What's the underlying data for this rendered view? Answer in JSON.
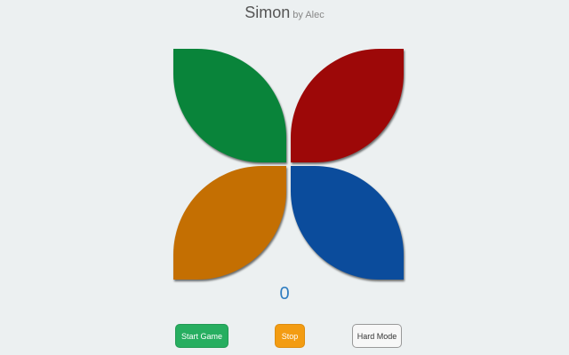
{
  "header": {
    "title": "Simon",
    "subtitle": "by Alec"
  },
  "board": {
    "pads": [
      {
        "name": "green",
        "color": "#09843a"
      },
      {
        "name": "red",
        "color": "#9d0808"
      },
      {
        "name": "orange",
        "color": "#c46f02"
      },
      {
        "name": "blue",
        "color": "#0b4c9c"
      }
    ]
  },
  "score": "0",
  "controls": {
    "start_label": "Start Game",
    "stop_label": "Stop",
    "hard_label": "Hard Mode"
  }
}
